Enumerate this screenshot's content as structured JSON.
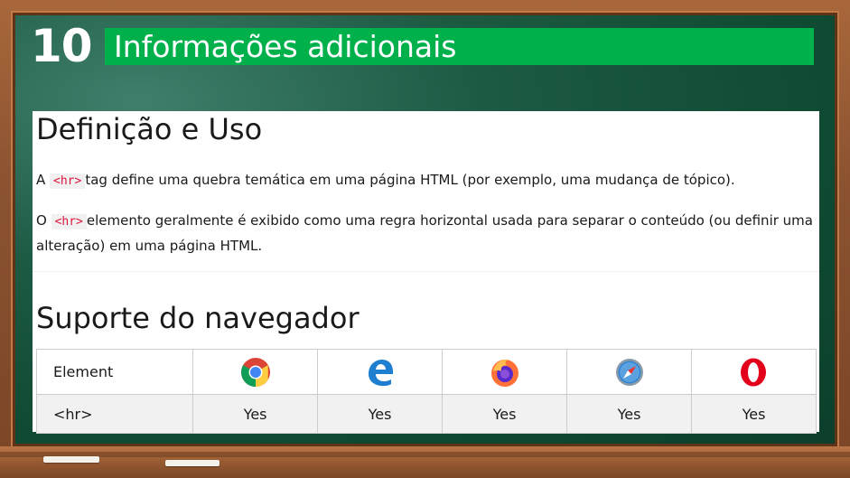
{
  "slide": {
    "number": "10",
    "title": "Informações adicionais"
  },
  "definition": {
    "heading": "Definição e Uso",
    "p1_prefix": "A ",
    "p1_code": "<hr>",
    "p1_suffix": "tag define uma quebra temática em uma página HTML (por exemplo, uma mudança de tópico).",
    "p2_prefix": "O ",
    "p2_code": "<hr>",
    "p2_suffix": "elemento geralmente é exibido como uma regra horizontal usada para separar o conteúdo (ou definir uma alteração) em uma página HTML."
  },
  "support": {
    "heading": "Suporte do navegador",
    "header_label": "Element",
    "browsers": [
      {
        "icon": "chrome-icon"
      },
      {
        "icon": "edge-icon"
      },
      {
        "icon": "firefox-icon"
      },
      {
        "icon": "safari-icon"
      },
      {
        "icon": "opera-icon"
      }
    ],
    "row": {
      "element": "<hr>",
      "values": [
        "Yes",
        "Yes",
        "Yes",
        "Yes",
        "Yes"
      ]
    }
  },
  "colors": {
    "title_bar": "#00b04b",
    "board": "#0f4a32",
    "frame": "#8a5230",
    "code_text": "#dc143c"
  }
}
